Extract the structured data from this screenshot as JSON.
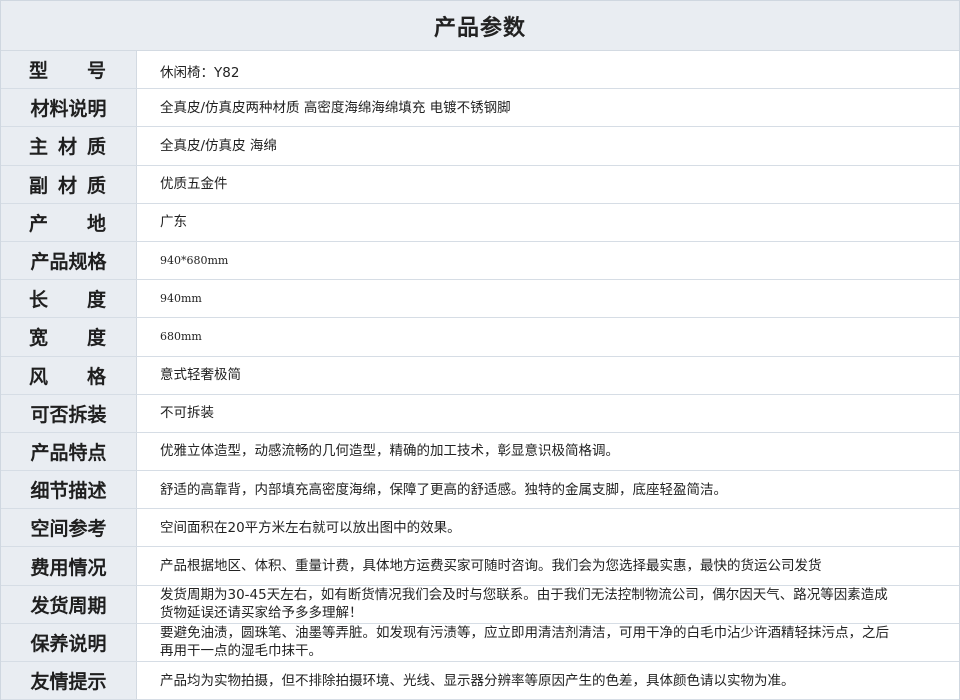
{
  "title": "产品参数",
  "rows": [
    {
      "label": [
        "型",
        "号"
      ],
      "value": "休闲椅：Y82"
    },
    {
      "label": [
        "材料说明"
      ],
      "value": "全真皮/仿真皮两种材质 高密度海绵海绵填充   电镀不锈钢脚"
    },
    {
      "label": [
        "主",
        "材",
        "质"
      ],
      "value": "全真皮/仿真皮 海绵"
    },
    {
      "label": [
        "副",
        "材",
        "质"
      ],
      "value": "优质五金件"
    },
    {
      "label": [
        "产",
        "地"
      ],
      "value": "广东"
    },
    {
      "label": [
        "产品规格"
      ],
      "value": "940*680mm"
    },
    {
      "label": [
        "长",
        "度"
      ],
      "value": "940mm"
    },
    {
      "label": [
        "宽",
        "度"
      ],
      "value": "680mm"
    },
    {
      "label": [
        "风",
        "格"
      ],
      "value": "意式轻奢极简"
    },
    {
      "label": [
        "可否拆装"
      ],
      "value": "不可拆装"
    },
    {
      "label": [
        "产品特点"
      ],
      "value": "优雅立体造型，动感流畅的几何造型，精确的加工技术，彰显意识极简格调。"
    },
    {
      "label": [
        "细节描述"
      ],
      "value": "舒适的高靠背，内部填充高密度海绵，保障了更高的舒适感。独特的金属支脚，底座轻盈简洁。"
    },
    {
      "label": [
        "空间参考"
      ],
      "value": "空间面积在20平方米左右就可以放出图中的效果。"
    },
    {
      "label": [
        "费用情况"
      ],
      "value": "产品根据地区、体积、重量计费，具体地方运费买家可随时咨询。我们会为您选择最实惠，最快的货运公司发货"
    },
    {
      "label": [
        "发货周期"
      ],
      "value": "发货周期为30-45天左右，如有断货情况我们会及时与您联系。由于我们无法控制物流公司，偶尔因天气、路况等因素造成货物延误还请买家给予多多理解！"
    },
    {
      "label": [
        "保养说明"
      ],
      "value": "要避免油渍，圆珠笔、油墨等弄脏。如发现有污渍等，应立即用清洁剂清洁，可用干净的白毛巾沾少许酒精轻抹污点，之后再用干一点的湿毛巾抹干。"
    },
    {
      "label": [
        "友情提示"
      ],
      "value": "产品均为实物拍摄，但不排除拍摄环境、光线、显示器分辨率等原因产生的色差，具体颜色请以实物为准。"
    }
  ]
}
